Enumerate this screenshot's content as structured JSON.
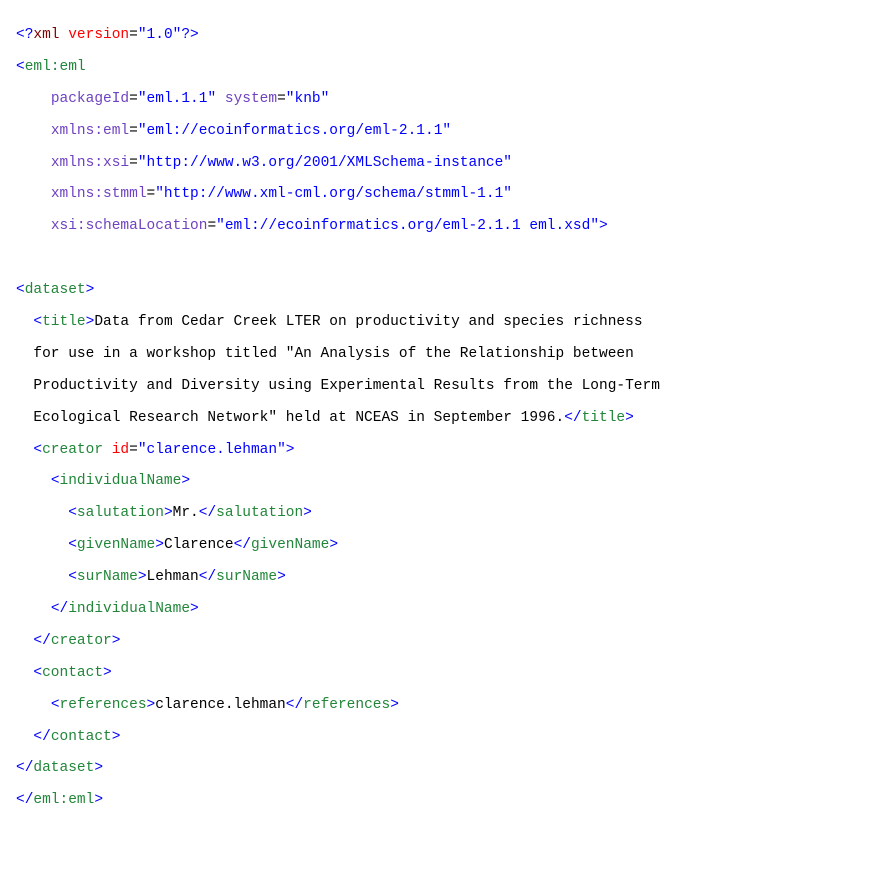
{
  "l1": {
    "a": "<?",
    "b": "xml",
    "c": " version",
    "d": "=",
    "e": "\"1.0\"",
    "f": "?>"
  },
  "l2": {
    "a": "<",
    "b": "eml:eml"
  },
  "l3": {
    "a": "packageId",
    "b": "=",
    "c": "\"eml.1.1\"",
    "d": " system",
    "e": "=",
    "f": "\"knb\""
  },
  "l4": {
    "a": "xmlns:eml",
    "b": "=",
    "c": "\"eml://ecoinformatics.org/eml-2.1.1\""
  },
  "l5": {
    "a": "xmlns:xsi",
    "b": "=",
    "c": "\"http://www.w3.org/2001/XMLSchema-instance\""
  },
  "l6": {
    "a": "xmlns:stmml",
    "b": "=",
    "c": "\"http://www.xml-cml.org/schema/stmml-1.1\""
  },
  "l7": {
    "a": "xsi:schemaLocation",
    "b": "=",
    "c": "\"eml://ecoinformatics.org/eml-2.1.1 eml.xsd\"",
    "d": ">"
  },
  "l8": {
    "a": "<",
    "b": "dataset",
    "c": ">"
  },
  "l9": {
    "a": "<",
    "b": "title",
    "c": ">",
    "d": "Data from Cedar Creek LTER on productivity and species richness"
  },
  "l10": {
    "a": "for use in a workshop titled \"An Analysis of the Relationship between"
  },
  "l11": {
    "a": "Productivity and Diversity using Experimental Results from the Long-Term"
  },
  "l12": {
    "a": "Ecological Research Network\" held at NCEAS in September 1996.",
    "b": "</",
    "c": "title",
    "d": ">"
  },
  "l13": {
    "a": "<",
    "b": "creator",
    "c": " id",
    "d": "=",
    "e": "\"clarence.lehman\"",
    "f": ">"
  },
  "l14": {
    "a": "<",
    "b": "individualName",
    "c": ">"
  },
  "l15": {
    "a": "<",
    "b": "salutation",
    "c": ">",
    "d": "Mr.",
    "e": "</",
    "f": "salutation",
    "g": ">"
  },
  "l16": {
    "a": "<",
    "b": "givenName",
    "c": ">",
    "d": "Clarence",
    "e": "</",
    "f": "givenName",
    "g": ">"
  },
  "l17": {
    "a": "<",
    "b": "surName",
    "c": ">",
    "d": "Lehman",
    "e": "</",
    "f": "surName",
    "g": ">"
  },
  "l18": {
    "a": "</",
    "b": "individualName",
    "c": ">"
  },
  "l19": {
    "a": "</",
    "b": "creator",
    "c": ">"
  },
  "l20": {
    "a": "<",
    "b": "contact",
    "c": ">"
  },
  "l21": {
    "a": "<",
    "b": "references",
    "c": ">",
    "d": "clarence.lehman",
    "e": "</",
    "f": "references",
    "g": ">"
  },
  "l22": {
    "a": "</",
    "b": "contact",
    "c": ">"
  },
  "l23": {
    "a": "</",
    "b": "dataset",
    "c": ">"
  },
  "l24": {
    "a": "</",
    "b": "eml:eml",
    "c": ">"
  }
}
